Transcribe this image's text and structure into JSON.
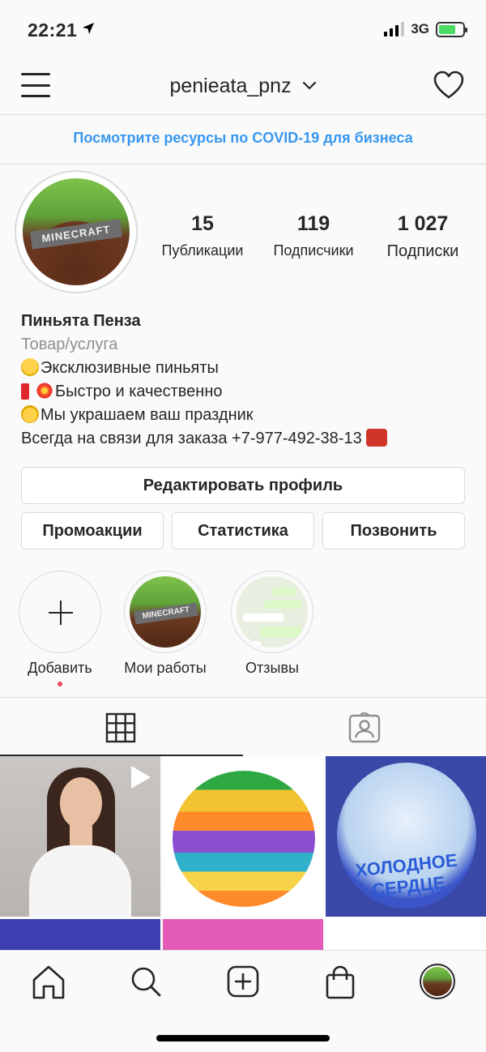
{
  "status": {
    "time": "22:21",
    "network": "3G"
  },
  "header": {
    "username": "penieata_pnz"
  },
  "banner": {
    "covid_text": "Посмотрите ресурсы по COVID-19 для бизнеса"
  },
  "profile": {
    "avatar_text": "MINECRAFT",
    "stats": [
      {
        "value": "15",
        "label": "Публикации"
      },
      {
        "value": "119",
        "label": "Подписчики"
      },
      {
        "value": "1 027",
        "label": "Подписки"
      }
    ],
    "name": "Пиньята Пенза",
    "category": "Товар/услуга",
    "bio": [
      "Эксклюзивные пиньяты",
      "Быстро и качественно",
      "Мы украшаем ваш праздник",
      "Всегда на связи для заказа +7-977-492-38-13"
    ]
  },
  "buttons": {
    "edit": "Редактировать профиль",
    "promo": "Промоакции",
    "stats": "Статистика",
    "call": "Позвонить"
  },
  "highlights": [
    {
      "label": "Добавить"
    },
    {
      "label": "Мои работы"
    },
    {
      "label": "Отзывы"
    }
  ],
  "posts": {
    "frozen_title": "ХОЛОДНОЕ СЕРДЦЕ"
  },
  "colors": {
    "link_blue": "#3897f0",
    "notification_red": "#ed4956",
    "border": "#dbdbdb"
  },
  "icons": [
    "location-arrow-icon",
    "signal-icon",
    "battery-icon",
    "menu-icon",
    "chevron-down-icon",
    "heart-icon",
    "plus-icon",
    "grid-icon",
    "tagged-icon",
    "play-icon",
    "home-icon",
    "search-icon",
    "add-post-icon",
    "shop-icon"
  ]
}
